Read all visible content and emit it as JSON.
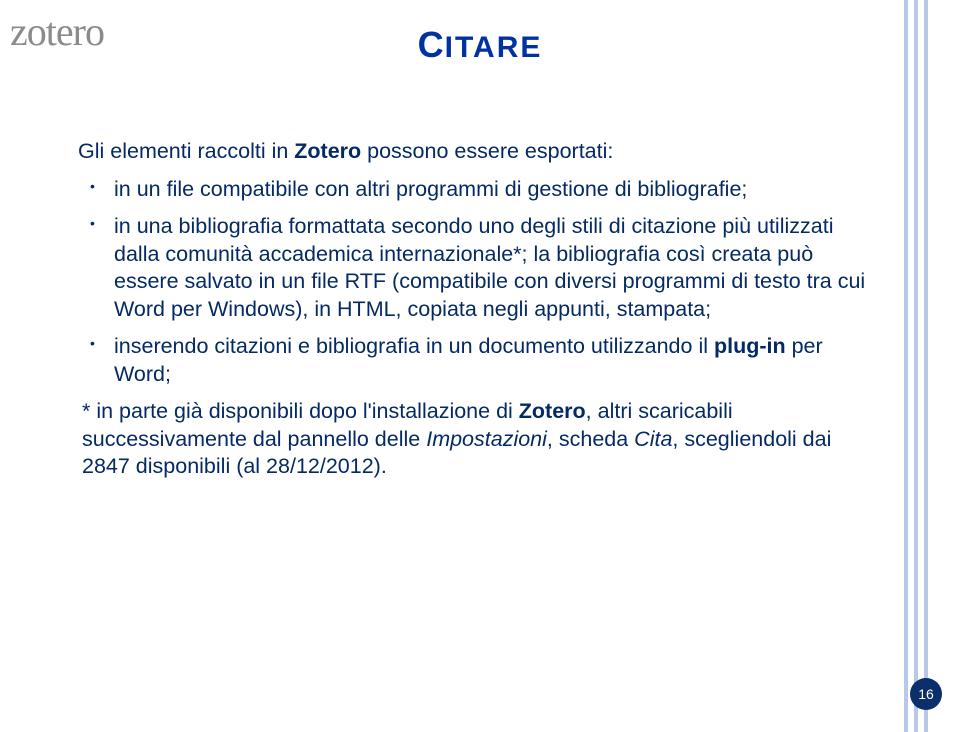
{
  "logo": "zotero",
  "title_first": "C",
  "title_rest": "ITARE",
  "intro": "Gli elementi raccolti in ",
  "intro_bold": "Zotero",
  "intro_after": " possono essere esportati:",
  "bullets": [
    {
      "pre": "in un file compatibile con altri programmi di gestione di bibliografie;"
    },
    {
      "pre": "in una bibliografia formattata secondo uno degli stili di citazione più utilizzati dalla comunità accademica internazionale*; la bibliografia così creata può essere salvato in un file RTF (compatibile con diversi programmi di testo tra cui Word per Windows), in HTML, copiata negli appunti, stampata;"
    },
    {
      "pre": "inserendo citazioni e bibliografia in un documento utilizzando il ",
      "bold": "plug-in",
      "post": " per Word;"
    }
  ],
  "footnote_pre": "* in parte già disponibili dopo l'installazione di ",
  "footnote_bold": "Zotero",
  "footnote_mid": ", altri scaricabili successivamente dal pannello delle ",
  "footnote_ital1": "Impostazioni",
  "footnote_sep": ", scheda ",
  "footnote_ital2": "Cita",
  "footnote_post": ", scegliendoli dai 2847 disponibili (al 28/12/2012).",
  "page_number": "16"
}
